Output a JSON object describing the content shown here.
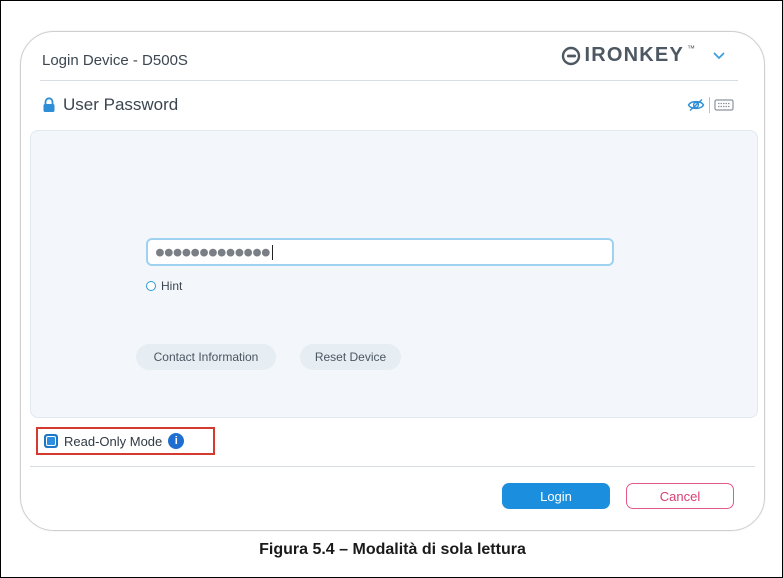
{
  "window": {
    "title": "Login Device - D500S",
    "brand": "IRONKEY",
    "brand_tm": "™"
  },
  "section": {
    "title": "User Password"
  },
  "password": {
    "masked_value": "●●●●●●●●●●●●●"
  },
  "hint": {
    "label": "Hint"
  },
  "buttons": {
    "contact_label": "Contact Information",
    "reset_label": "Reset Device",
    "login_label": "Login",
    "cancel_label": "Cancel"
  },
  "read_only": {
    "label": "Read-Only Mode",
    "checked": true,
    "info_glyph": "i"
  },
  "caption": "Figura 5.4 – Modalità di sola lettura",
  "icons": [
    "lock-icon",
    "eye-off-icon",
    "keyboard-icon",
    "chevron-down-icon",
    "info-icon",
    "ironkey-logo-icon"
  ],
  "colors": {
    "accent": "#1c8ede",
    "cancel": "#d83f72",
    "highlight_border": "#d43a2f",
    "panel_bg": "#f3f7fb"
  }
}
